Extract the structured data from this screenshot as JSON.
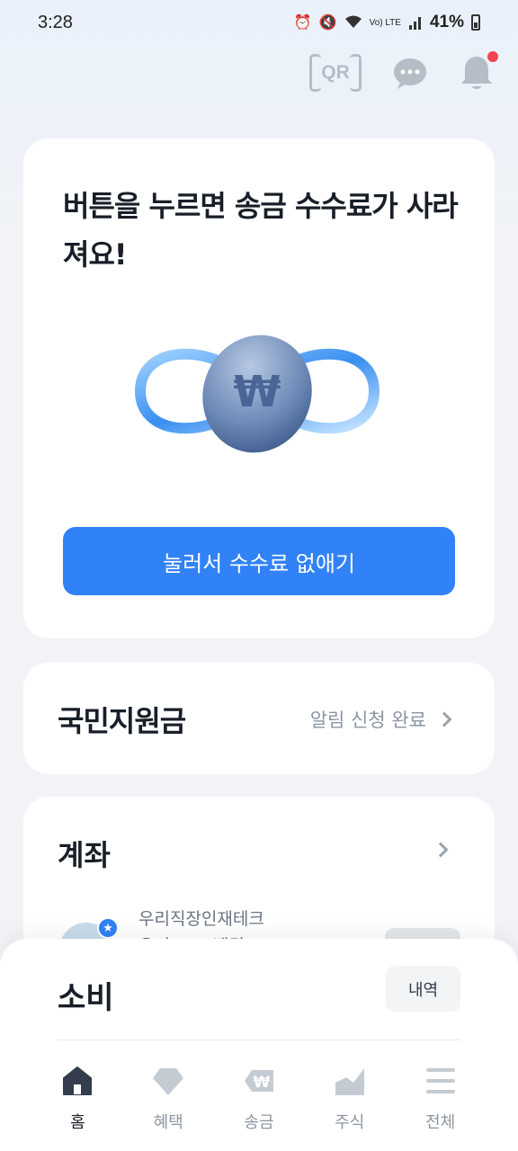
{
  "status_bar": {
    "time": "3:28",
    "battery": "41%",
    "volte": "Vo) LTE"
  },
  "header": {
    "qr_label": "QR",
    "notification_dot_color": "#f04452"
  },
  "promo": {
    "title": "버튼을 누르면 송금 수수료가 사라져요!",
    "button_label": "눌러서 수수료 없애기",
    "accent_color": "#3182f6"
  },
  "subsidy": {
    "title": "국민지원금",
    "status": "알림 신청 완료"
  },
  "accounts": {
    "title": "계좌",
    "item_name": "우리직장인재테크",
    "item_sub": "우리WON뱅킹"
  },
  "spending": {
    "title": "소비",
    "history_label": "내역"
  },
  "tabs": [
    {
      "label": "홈",
      "icon": "home-icon",
      "active": true
    },
    {
      "label": "혜택",
      "icon": "gem-icon",
      "active": false
    },
    {
      "label": "송금",
      "icon": "won-transfer-icon",
      "active": false
    },
    {
      "label": "주식",
      "icon": "chart-icon",
      "active": false
    },
    {
      "label": "전체",
      "icon": "menu-icon",
      "active": false
    }
  ]
}
